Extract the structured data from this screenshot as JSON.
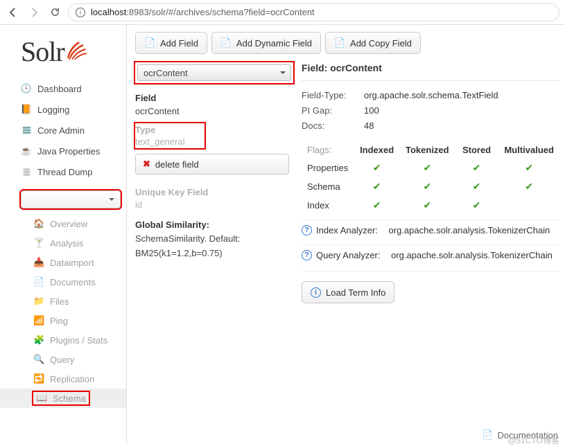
{
  "url": {
    "host": "localhost",
    "port": ":8983",
    "path": "/solr/#/archives/schema?field=ocrContent"
  },
  "logo": "Solr",
  "nav": {
    "dashboard": "Dashboard",
    "logging": "Logging",
    "core_admin": "Core Admin",
    "java_props": "Java Properties",
    "thread_dump": "Thread Dump"
  },
  "core_subnav": {
    "overview": "Overview",
    "analysis": "Analysis",
    "dataimport": "Dataimport",
    "documents": "Documents",
    "files": "Files",
    "ping": "Ping",
    "plugins": "Plugins / Stats",
    "query": "Query",
    "replication": "Replication",
    "schema": "Schema"
  },
  "toolbar": {
    "add_field": "Add Field",
    "add_dynamic": "Add Dynamic Field",
    "add_copy": "Add Copy Field"
  },
  "left": {
    "selected_field": "ocrContent",
    "field_label": "Field",
    "field_value": "ocrContent",
    "type_label": "Type",
    "type_value": "text_general",
    "delete_label": "delete field",
    "uk_label": "Unique Key Field",
    "uk_value": "id",
    "gs_label": "Global Similarity:",
    "gs_value": "SchemaSimilarity. Default: BM25(k1=1.2,b=0.75)"
  },
  "right": {
    "title": "Field: ocrContent",
    "rows": {
      "ft_k": "Field-Type:",
      "ft_v": "org.apache.solr.schema.TextField",
      "pi_k": "PI Gap:",
      "pi_v": "100",
      "docs_k": "Docs:",
      "docs_v": "48"
    },
    "flags_header": [
      "Flags:",
      "Indexed",
      "Tokenized",
      "Stored",
      "Multivalued"
    ],
    "flags_rows": [
      {
        "name": "Properties",
        "vals": [
          true,
          true,
          true,
          true
        ]
      },
      {
        "name": "Schema",
        "vals": [
          true,
          true,
          true,
          true
        ]
      },
      {
        "name": "Index",
        "vals": [
          true,
          true,
          true,
          false
        ]
      }
    ],
    "index_ana_label": "Index Analyzer:",
    "index_ana_val": "org.apache.solr.analysis.TokenizerChain",
    "query_ana_label": "Query Analyzer:",
    "query_ana_val": "org.apache.solr.analysis.TokenizerChain",
    "load_term": "Load Term Info"
  },
  "footer": {
    "doc": "Documentation"
  },
  "watermark": "@51CTO博客"
}
